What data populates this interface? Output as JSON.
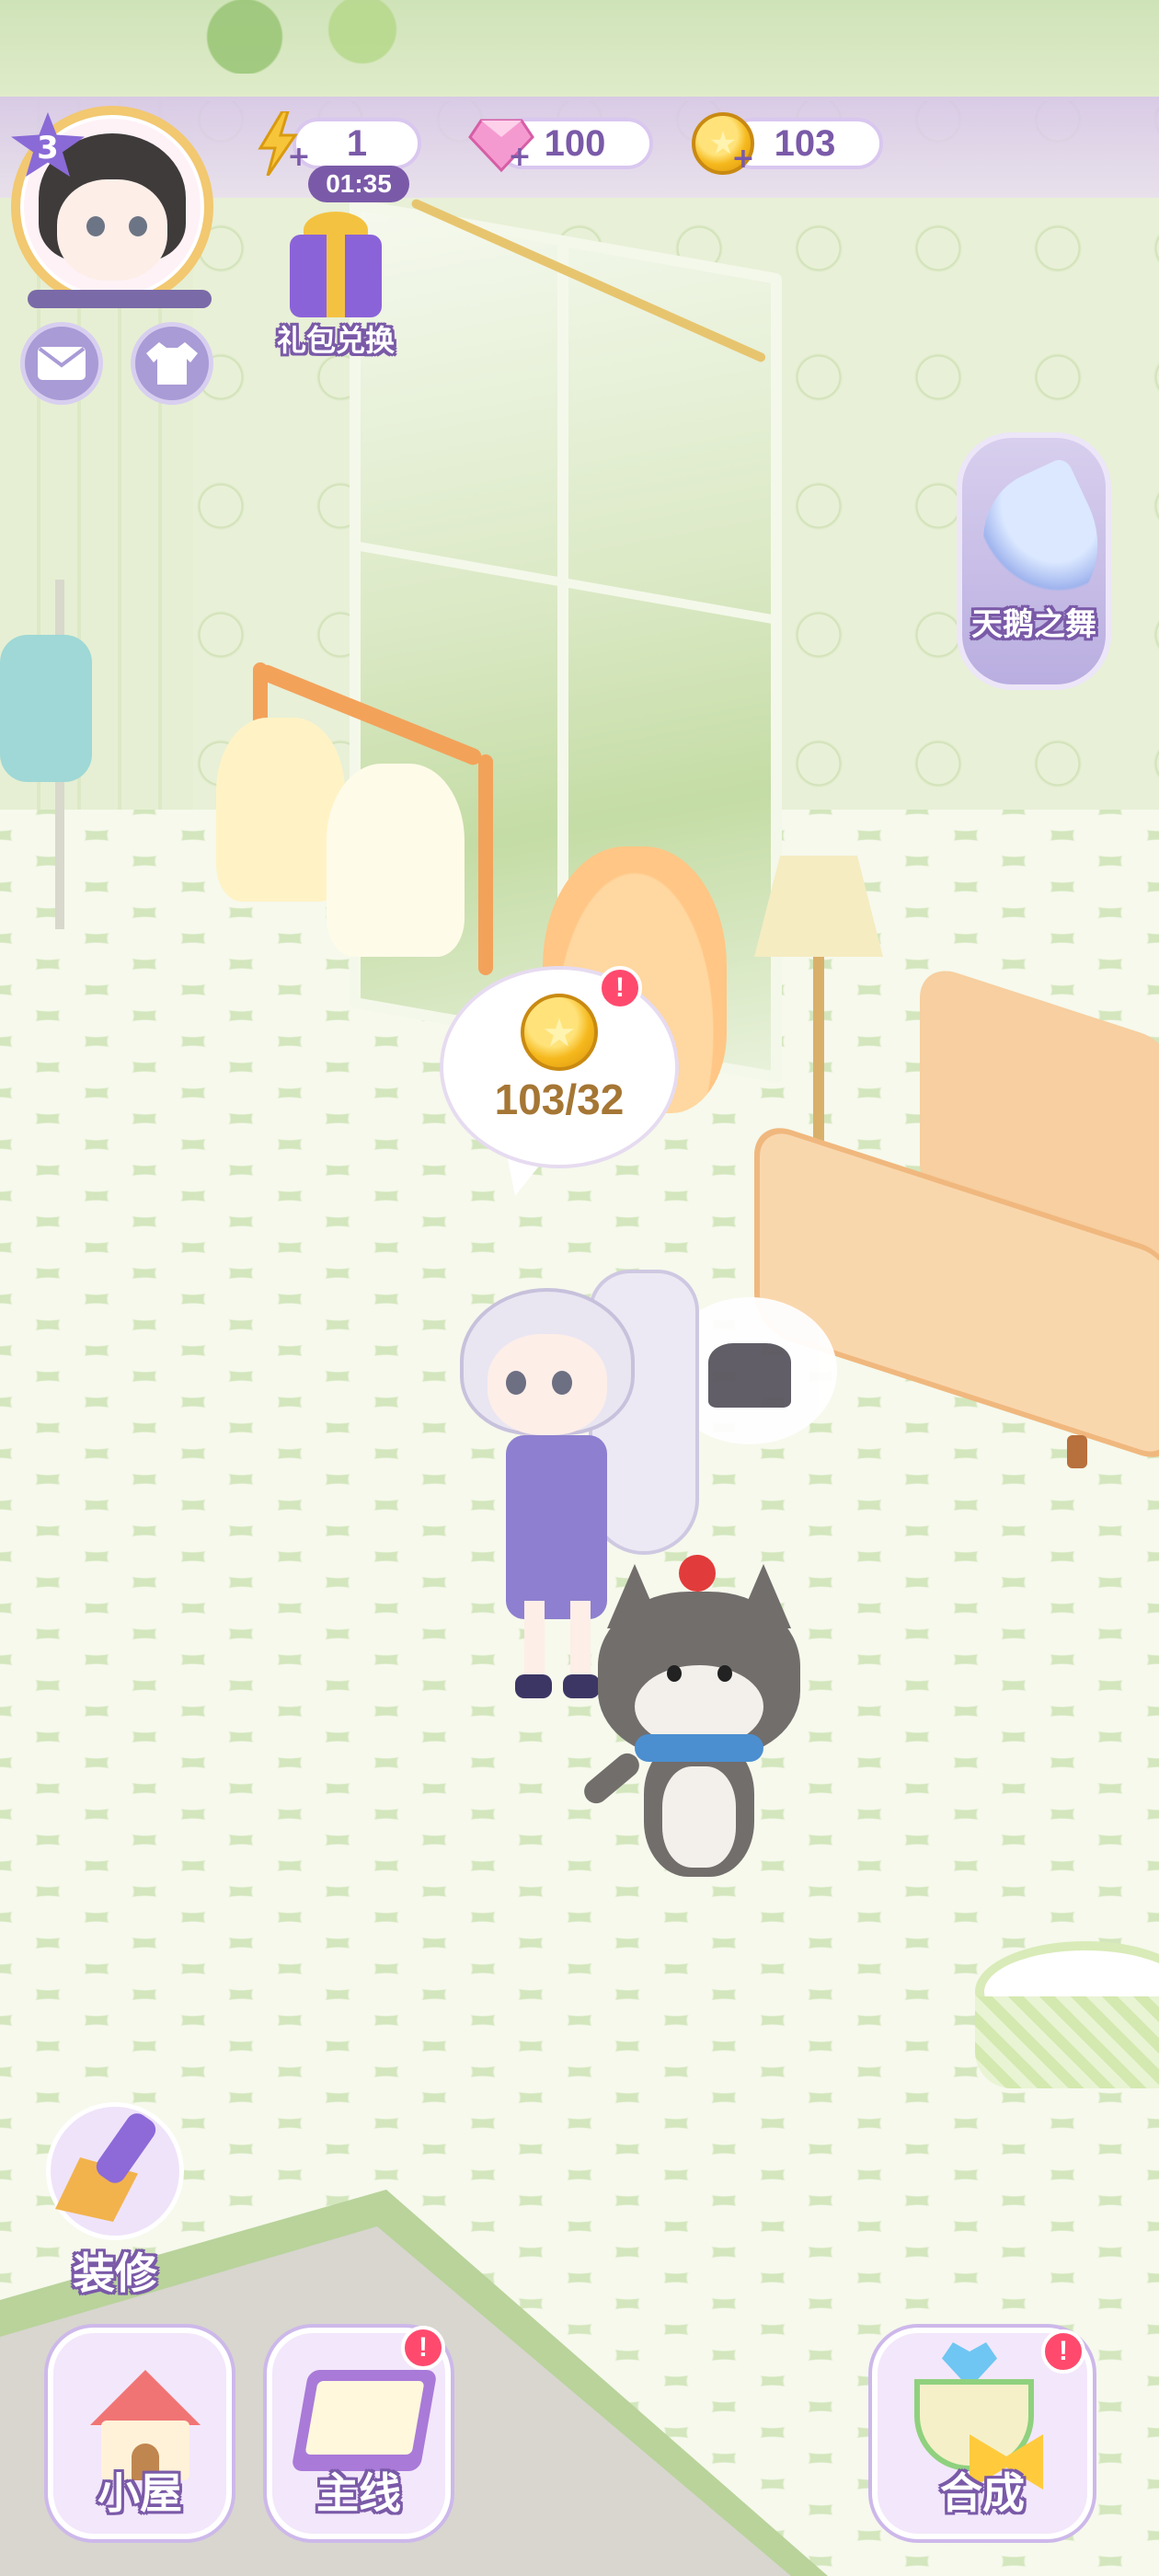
{
  "hud": {
    "level": "3",
    "energy": {
      "value": "1",
      "timer": "01:35",
      "icon": "lightning-icon"
    },
    "gems": {
      "value": "100",
      "icon": "gem-icon"
    },
    "coins": {
      "value": "103",
      "icon": "coin-icon"
    }
  },
  "side_buttons": {
    "mail": {
      "icon": "envelope-icon"
    },
    "wardrobe": {
      "icon": "shirt-icon"
    },
    "gift_redeem": {
      "label": "礼包兑换",
      "icon": "gift-box-icon"
    }
  },
  "event": {
    "label": "天鹅之舞",
    "icon": "feather-icon"
  },
  "coin_bubble": {
    "text": "103/32",
    "alert": "!"
  },
  "decorate": {
    "label": "装修",
    "icon": "brush-icon"
  },
  "bottom_nav": [
    {
      "label": "小屋",
      "icon": "house-icon",
      "alert": ""
    },
    {
      "label": "主线",
      "icon": "book-icon",
      "alert": "!"
    },
    {
      "label": "合成",
      "icon": "teacup-icon",
      "alert": "!"
    }
  ],
  "colors": {
    "accent": "#7a5aa8",
    "hud_bar": "#d6c4e8",
    "alert": "#ff4a6e",
    "coin": "#f5b81c",
    "floor": "#d3e6bd"
  }
}
